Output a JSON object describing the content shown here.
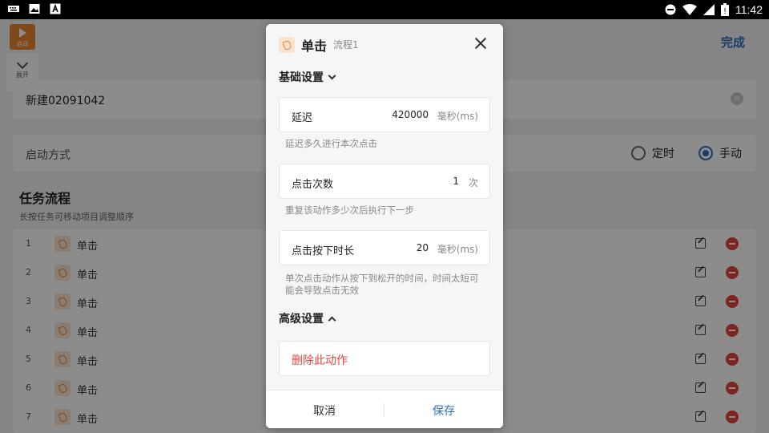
{
  "statusbar": {
    "time": "11:42",
    "battery": "!"
  },
  "toolbar": {
    "run_label": "启动",
    "expand_label": "展开",
    "done_label": "完成"
  },
  "task_name": "新建02091042",
  "start": {
    "label": "启动方式",
    "options": [
      {
        "label": "定时",
        "selected": false
      },
      {
        "label": "手动",
        "selected": true
      }
    ]
  },
  "flow": {
    "title": "任务流程",
    "subtitle": "长按任务可移动项目调整顺序",
    "rows": [
      {
        "num": "1",
        "name": "单击"
      },
      {
        "num": "2",
        "name": "单击"
      },
      {
        "num": "3",
        "name": "单击"
      },
      {
        "num": "4",
        "name": "单击"
      },
      {
        "num": "5",
        "name": "单击"
      },
      {
        "num": "6",
        "name": "单击"
      },
      {
        "num": "7",
        "name": "单击"
      }
    ]
  },
  "dialog": {
    "title": "单击",
    "subtitle": "流程1",
    "basic_heading": "基础设置",
    "delay": {
      "label": "延迟",
      "value": "420000",
      "unit": "毫秒(ms)",
      "hint": "延迟多久进行本次点击"
    },
    "count": {
      "label": "点击次数",
      "value": "1",
      "unit": "次",
      "hint": "重复该动作多少次后执行下一步"
    },
    "press": {
      "label": "点击按下时长",
      "value": "20",
      "unit": "毫秒(ms)",
      "hint": "单次点击动作从按下到松开的时间，时间太短可能会导致点击无效"
    },
    "advanced_heading": "高级设置",
    "delete_label": "删除此动作",
    "cancel_label": "取消",
    "save_label": "保存"
  },
  "colors": {
    "accent": "#2f6fb7",
    "danger": "#e0453f",
    "orange": "#e9862e"
  }
}
